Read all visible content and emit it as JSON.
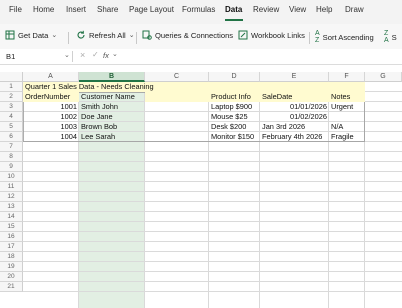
{
  "ribbon": {
    "tabs": [
      "File",
      "Home",
      "Insert",
      "Share",
      "Page Layout",
      "Formulas",
      "Data",
      "Review",
      "View",
      "Help",
      "Draw"
    ],
    "active_tab": "Data",
    "commands": {
      "get_data": "Get Data",
      "refresh_all": "Refresh All",
      "queries": "Queries & Connections",
      "workbook_links": "Workbook Links",
      "sort_ascending": "Sort Ascending",
      "sort_desc_partial": "S"
    }
  },
  "formula_bar": {
    "name_box": "B1",
    "fx": "fx",
    "value": ""
  },
  "columns": [
    "A",
    "B",
    "C",
    "D",
    "E",
    "F",
    "G"
  ],
  "rows": [
    "1",
    "2",
    "3",
    "4",
    "5",
    "6",
    "7",
    "8",
    "9",
    "10",
    "11",
    "12",
    "13",
    "14",
    "15",
    "16",
    "17",
    "18",
    "19",
    "20",
    "21"
  ],
  "cells": {
    "r1": {
      "a": "Quarter 1 Sales Data - Needs Cleaning"
    },
    "r2": {
      "a": "OrderNumber",
      "b": "Customer Name",
      "d": "Product Info",
      "e": "SaleDate",
      "f": "Notes"
    },
    "r3": {
      "a": "1001",
      "b": "Smith John",
      "d": "Laptop $900",
      "e": "01/01/2026",
      "f": "Urgent"
    },
    "r4": {
      "a": "1002",
      "b": "Doe Jane",
      "d": "Mouse $25",
      "e": "01/02/2026",
      "f": ""
    },
    "r5": {
      "a": "1003",
      "b": "Brown Bob",
      "d": "Desk $200",
      "e": "Jan 3rd 2026",
      "f": "N/A"
    },
    "r6": {
      "a": "1004",
      "b": "Lee Sarah",
      "d": "Monitor $150",
      "e": "February 4th 2026",
      "f": "Fragile"
    }
  },
  "colors": {
    "accent": "#217346",
    "selected_column": "#e2efe3",
    "header_fill": "#fffbd0",
    "grid_line": "#d6d6d6"
  }
}
